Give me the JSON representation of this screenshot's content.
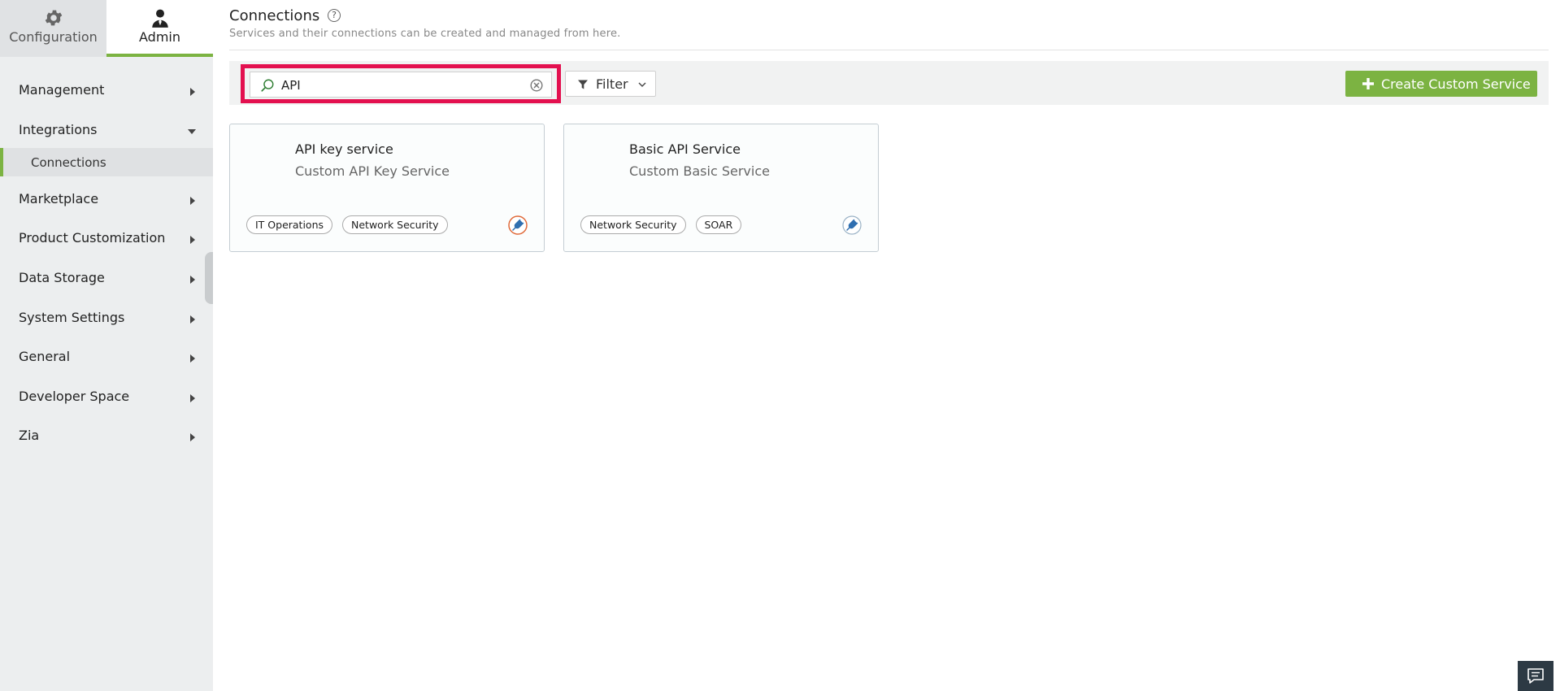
{
  "top_tabs": {
    "configuration": {
      "label": "Configuration",
      "icon": "gear-icon"
    },
    "admin": {
      "label": "Admin",
      "icon": "user-icon"
    }
  },
  "sidebar": {
    "items": [
      {
        "label": "Management",
        "state": "collapsed"
      },
      {
        "label": "Integrations",
        "state": "expanded"
      },
      {
        "label": "Connections",
        "state": "selected-subitem"
      },
      {
        "label": "Marketplace",
        "state": "collapsed"
      },
      {
        "label": "Product Customization",
        "state": "collapsed"
      },
      {
        "label": "Data Storage",
        "state": "collapsed"
      },
      {
        "label": "System Settings",
        "state": "collapsed"
      },
      {
        "label": "General",
        "state": "collapsed"
      },
      {
        "label": "Developer Space",
        "state": "collapsed"
      },
      {
        "label": "Zia",
        "state": "collapsed"
      }
    ]
  },
  "header": {
    "title": "Connections",
    "help": "?",
    "subtitle": "Services and their connections can be created and managed from here."
  },
  "toolbar": {
    "search_value": "API",
    "filter_label": "Filter",
    "create_label": "Create Custom Service"
  },
  "cards": [
    {
      "title": "API key service",
      "subtitle": "Custom API Key Service",
      "tags": [
        "IT Operations",
        "Network Security"
      ],
      "icon": "plug-icon"
    },
    {
      "title": "Basic API Service",
      "subtitle": "Custom Basic Service",
      "tags": [
        "Network Security",
        "SOAR"
      ],
      "icon": "plug-icon"
    }
  ],
  "colors": {
    "accent": "#7cb342",
    "highlight": "#e3104f",
    "plug_icon": "#2f6fb0",
    "plug_ring_active": "#e06a3a",
    "plug_ring": "#9bb3c6"
  }
}
